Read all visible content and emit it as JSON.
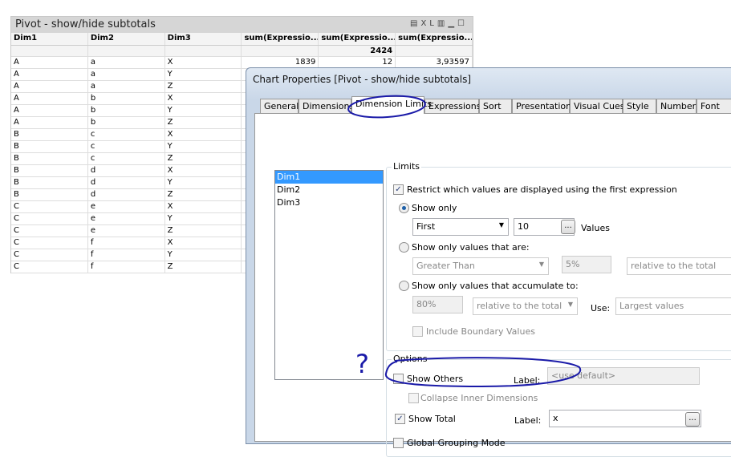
{
  "pivot": {
    "title": "Pivot - show/hide subtotals",
    "icons": [
      "print-icon",
      "xl-icon",
      "chart-icon",
      "minimize-icon",
      "maximize-icon"
    ],
    "icon_labels": {
      "xl": "XL"
    },
    "headers": [
      "Dim1",
      "Dim2",
      "Dim3",
      "sum(Expressio...",
      "sum(Expressio...",
      "sum(Expressio..."
    ],
    "total_row": [
      "",
      "",
      "",
      "",
      "2424",
      ""
    ],
    "rows": [
      [
        "A",
        "a",
        "X",
        "1839",
        "12",
        "3,93597"
      ],
      [
        "A",
        "a",
        "Y",
        "",
        "",
        ""
      ],
      [
        "A",
        "a",
        "Z",
        "",
        "",
        ""
      ],
      [
        "A",
        "b",
        "X",
        "",
        "",
        ""
      ],
      [
        "A",
        "b",
        "Y",
        "",
        "",
        ""
      ],
      [
        "A",
        "b",
        "Z",
        "",
        "",
        ""
      ],
      [
        "B",
        "c",
        "X",
        "",
        "",
        ""
      ],
      [
        "B",
        "c",
        "Y",
        "",
        "",
        ""
      ],
      [
        "B",
        "c",
        "Z",
        "",
        "",
        ""
      ],
      [
        "B",
        "d",
        "X",
        "",
        "",
        ""
      ],
      [
        "B",
        "d",
        "Y",
        "",
        "",
        ""
      ],
      [
        "B",
        "d",
        "Z",
        "",
        "",
        ""
      ],
      [
        "C",
        "e",
        "X",
        "",
        "",
        ""
      ],
      [
        "C",
        "e",
        "Y",
        "",
        "",
        ""
      ],
      [
        "C",
        "e",
        "Z",
        "",
        "",
        ""
      ],
      [
        "C",
        "f",
        "X",
        "",
        "",
        ""
      ],
      [
        "C",
        "f",
        "Y",
        "",
        "",
        ""
      ],
      [
        "C",
        "f",
        "Z",
        "",
        "",
        ""
      ]
    ]
  },
  "dialog": {
    "title": "Chart Properties [Pivot - show/hide subtotals]",
    "tabs": [
      "General",
      "Dimensions",
      "Dimension Limits",
      "Expressions",
      "Sort",
      "Presentation",
      "Visual Cues",
      "Style",
      "Number",
      "Font"
    ],
    "selected_tab": "Dimension Limits",
    "dimensions": [
      "Dim1",
      "Dim2",
      "Dim3"
    ],
    "limits": {
      "group": "Limits",
      "restrict": "Restrict which values are displayed using the first expression",
      "show_only": "Show only",
      "first": "First",
      "count": "10",
      "values": "Values",
      "ellipsis": "...",
      "show_values_are": "Show only values that are:",
      "greater_than": "Greater Than",
      "pct": "5%",
      "relative": "relative to the total",
      "accumulate": "Show only values that accumulate to:",
      "acc_pct": "80%",
      "acc_relative": "relative to the total",
      "use": "Use:",
      "largest": "Largest values",
      "include_boundary": "Include Boundary Values"
    },
    "options": {
      "group": "Options",
      "show_others": "Show Others",
      "label": "Label:",
      "others_placeholder": "<use default>",
      "collapse": "Collapse Inner Dimensions",
      "show_total": "Show Total",
      "total_label": "x",
      "ellipsis": "...",
      "global_grouping": "Global Grouping Mode"
    }
  },
  "annotation": {
    "question": "?",
    "color": "#1a1aa8"
  }
}
